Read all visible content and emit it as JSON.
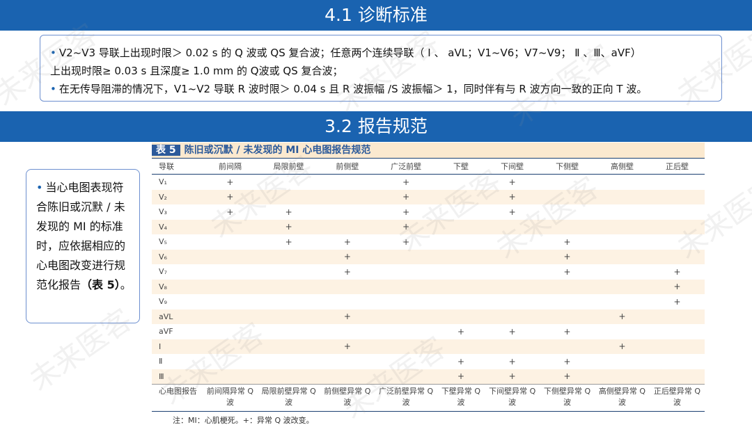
{
  "section1": {
    "title": "4.1 诊断标准",
    "criteria": [
      "V2~V3 导联上出现时限＞ 0.02 s 的 Q 波或 QS 复合波；任意两个连续导联（ Ⅰ 、 aVL；V1~V6；V7~V9； Ⅱ 、Ⅲ、aVF）",
      "上出现时限≥ 0.03 s 且深度≥ 1.0 mm 的 Q波或 QS 复合波；",
      "在无传导阻滞的情况下，V1~V2 导联 R 波时限＞ 0.04 s 且 R 波振幅 /S 波振幅＞ 1，同时伴有与 R 波方向一致的正向 T 波。"
    ]
  },
  "section2": {
    "title": "3.2 报告规范",
    "side_text": "当心电图表现符合陈旧或沉默 / 未发现的 MI 的标准时，应依据相应的心电图改变进行规范化报告",
    "side_ref": "（表 5）",
    "side_end": "。"
  },
  "table": {
    "num": "表 5",
    "title": "陈旧或沉默 / 未发现的 MI 心电图报告规范",
    "headers": [
      "导联",
      "前间隔",
      "局限前壁",
      "前侧壁",
      "广泛前壁",
      "下壁",
      "下间壁",
      "下侧壁",
      "高侧壁",
      "正后壁"
    ],
    "rows": [
      [
        "V₁",
        "+",
        "",
        "",
        "+",
        "",
        "+",
        "",
        "",
        ""
      ],
      [
        "V₂",
        "+",
        "",
        "",
        "+",
        "",
        "+",
        "",
        "",
        ""
      ],
      [
        "V₃",
        "+",
        "+",
        "",
        "+",
        "",
        "+",
        "",
        "",
        ""
      ],
      [
        "V₄",
        "",
        "+",
        "",
        "+",
        "",
        "",
        "",
        "",
        ""
      ],
      [
        "V₅",
        "",
        "+",
        "+",
        "+",
        "",
        "",
        "+",
        "",
        ""
      ],
      [
        "V₆",
        "",
        "",
        "+",
        "",
        "",
        "",
        "+",
        "",
        ""
      ],
      [
        "V₇",
        "",
        "",
        "+",
        "",
        "",
        "",
        "+",
        "",
        "+"
      ],
      [
        "V₈",
        "",
        "",
        "",
        "",
        "",
        "",
        "",
        "",
        "+"
      ],
      [
        "V₉",
        "",
        "",
        "",
        "",
        "",
        "",
        "",
        "",
        "+"
      ],
      [
        "aVL",
        "",
        "",
        "+",
        "",
        "",
        "",
        "",
        "+",
        ""
      ],
      [
        "aVF",
        "",
        "",
        "",
        "",
        "+",
        "+",
        "+",
        "",
        ""
      ],
      [
        "Ⅰ",
        "",
        "",
        "+",
        "",
        "",
        "",
        "",
        "+",
        ""
      ],
      [
        "Ⅱ",
        "",
        "",
        "",
        "",
        "+",
        "+",
        "+",
        "",
        ""
      ],
      [
        "Ⅲ",
        "",
        "",
        "",
        "",
        "+",
        "+",
        "+",
        "",
        ""
      ]
    ],
    "footer_label": "心电图报告",
    "footer": [
      "前间隔异常 Q 波",
      "局限前壁异常 Q 波",
      "前侧壁异常 Q 波",
      "广泛前壁异常 Q 波",
      "下壁异常 Q 波",
      "下间壁异常 Q 波",
      "下侧壁异常 Q 波",
      "高侧壁异常 Q 波",
      "正后壁异常 Q 波"
    ],
    "note": "注：MI：心肌梗死。+：异常 Q 波改变。"
  },
  "watermark": "未来医客",
  "colors": {
    "banner": "#1a63b0",
    "border": "#6c8fcf",
    "table_title": "#2c5a9a",
    "stripe": "#fdf2e3"
  }
}
